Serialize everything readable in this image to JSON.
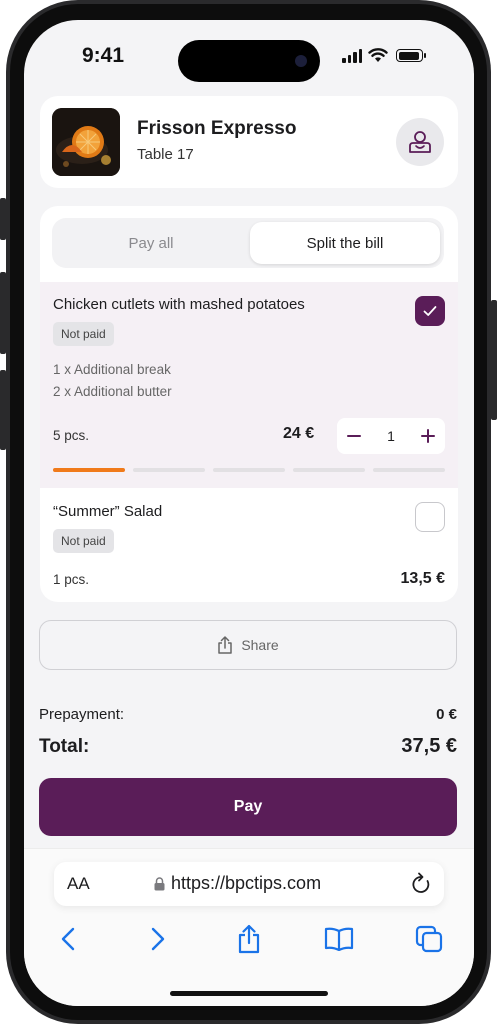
{
  "status_bar": {
    "time": "9:41"
  },
  "restaurant": {
    "name": "Frisson Expresso",
    "table": "Table 17"
  },
  "tabs": {
    "pay_all": "Pay all",
    "split_bill": "Split the bill",
    "active": "split_bill"
  },
  "items": [
    {
      "name": "Chicken cutlets with mashed potatoes",
      "status": "Not paid",
      "selected": true,
      "modifiers": [
        "1 x Additional break",
        "2 x Additional butter"
      ],
      "quantity": "5 pcs.",
      "price": "24 €",
      "stepper_value": "1",
      "progress_segments": 5,
      "progress_filled": 1
    },
    {
      "name": "“Summer” Salad",
      "status": "Not paid",
      "selected": false,
      "quantity": "1 pcs.",
      "price": "13,5 €"
    }
  ],
  "share_label": "Share",
  "summary": {
    "prepayment_label": "Prepayment:",
    "prepayment_value": "0 €",
    "total_label": "Total:",
    "total_value": "37,5 €"
  },
  "pay_label": "Pay",
  "browser": {
    "aa_label": "AA",
    "url": "https://bpctips.com"
  },
  "colors": {
    "accent": "#5a1d58",
    "progress": "#f07a1a",
    "background": "#f4f4f6"
  }
}
